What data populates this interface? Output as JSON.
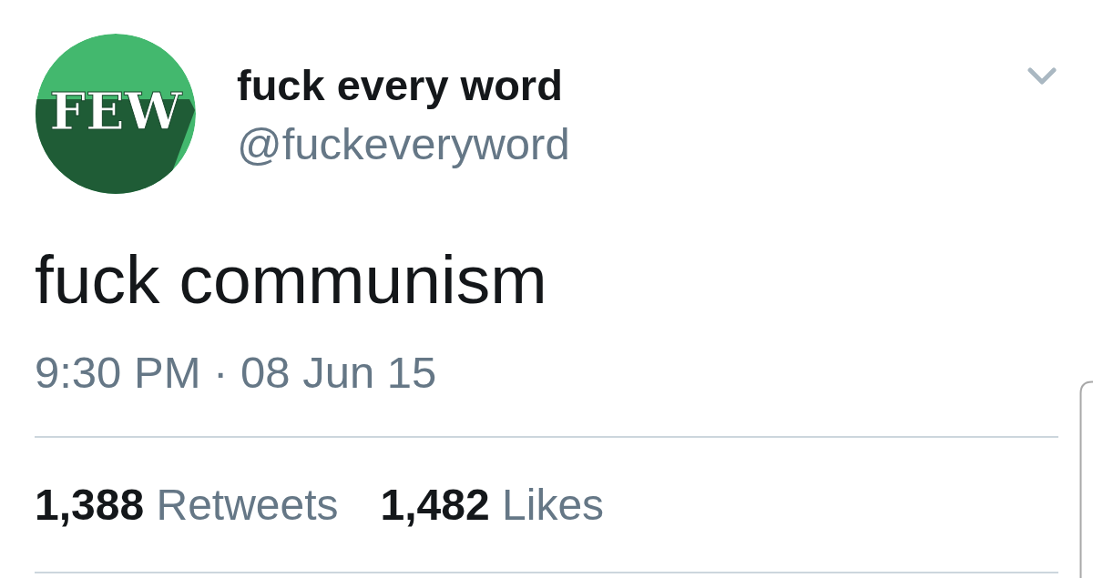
{
  "tweet": {
    "author": {
      "avatar_text": "FEW",
      "name": "fuck every word",
      "handle": "@fuckeveryword"
    },
    "text": "fuck communism",
    "timestamp": "9:30 PM · 08 Jun 15",
    "stats": [
      {
        "count": "1,388",
        "label": "Retweets"
      },
      {
        "count": "1,482",
        "label": "Likes"
      }
    ]
  }
}
